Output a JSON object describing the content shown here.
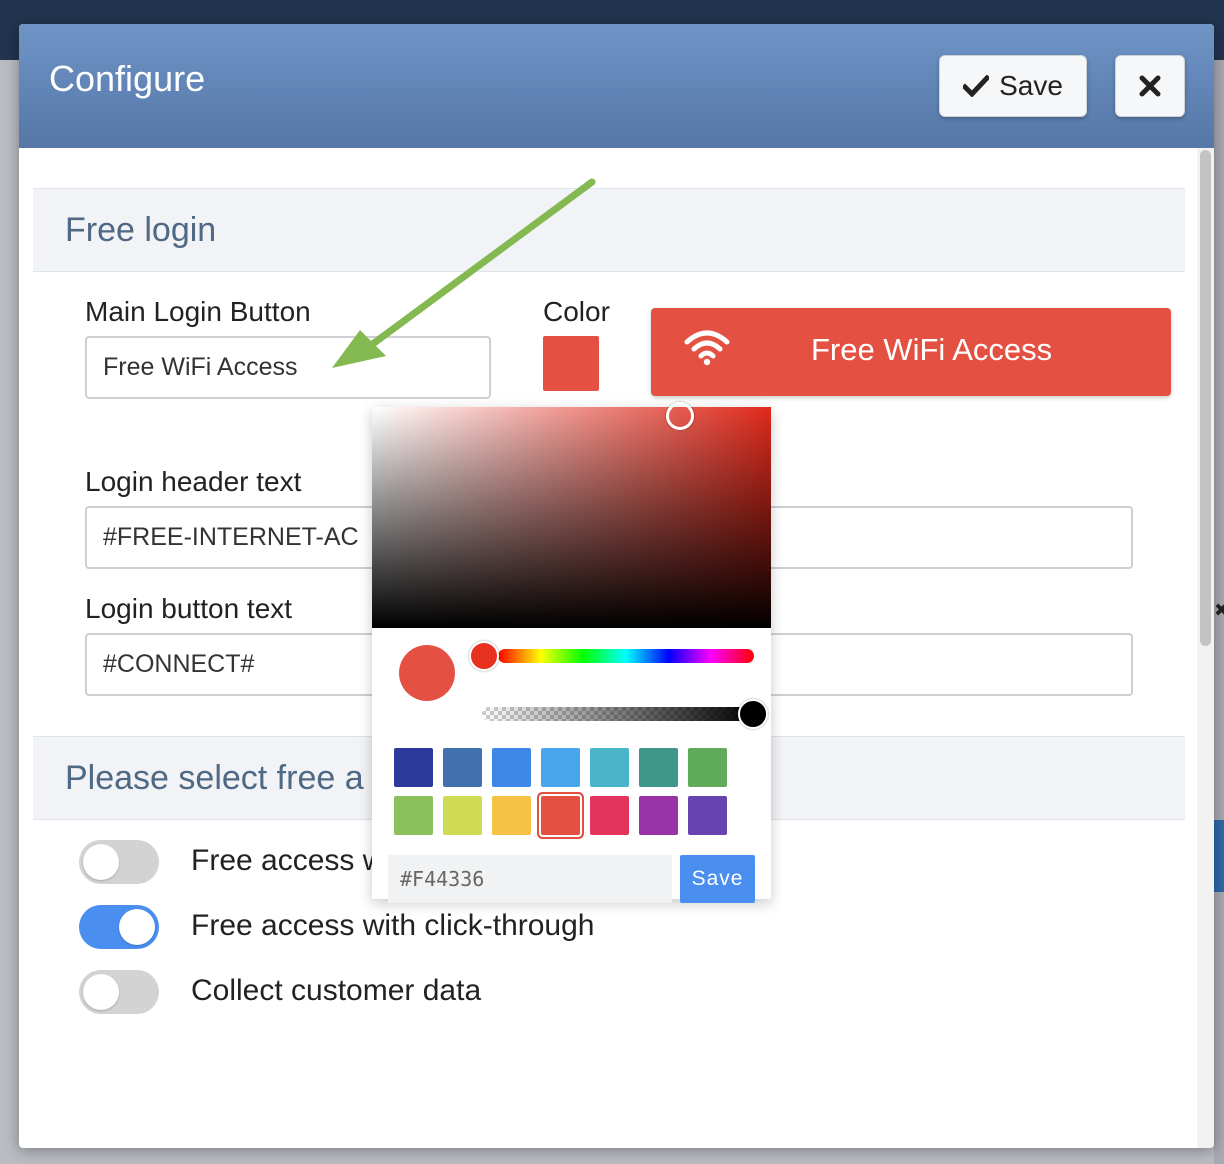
{
  "dialog": {
    "title": "Configure",
    "save_label": "Save",
    "save_icon": "check-icon",
    "close_icon": "close-icon"
  },
  "section_free_login": {
    "title": "Free login"
  },
  "main_login_button": {
    "label": "Main Login Button",
    "value": "Free WiFi Access"
  },
  "color": {
    "label": "Color",
    "value": "#F44336"
  },
  "preview_button": {
    "icon": "wifi-icon",
    "label": "Free WiFi Access",
    "color": "#e45142"
  },
  "login_header_text": {
    "label": "Login header text",
    "value": "#FREE-INTERNET-AC"
  },
  "login_button_text": {
    "label": "Login button text",
    "value": "#CONNECT#"
  },
  "section_select": {
    "title": "Please select free a"
  },
  "options": [
    {
      "label": "Free access w",
      "on": false
    },
    {
      "label": "Free access with click-through",
      "on": true
    },
    {
      "label": "Collect customer data",
      "on": false
    }
  ],
  "color_picker": {
    "hex_value": "#F44336",
    "save_label": "Save",
    "hue_position": 0.0,
    "alpha": 1.0,
    "swatches": [
      {
        "color": "#2c3a9b",
        "selected": false
      },
      {
        "color": "#4070ad",
        "selected": false
      },
      {
        "color": "#3d87e6",
        "selected": false
      },
      {
        "color": "#4aa6ec",
        "selected": false
      },
      {
        "color": "#4ab4c8",
        "selected": false
      },
      {
        "color": "#3d9687",
        "selected": false
      },
      {
        "color": "#5fab5a",
        "selected": false
      },
      {
        "color": "#8cc05b",
        "selected": false
      },
      {
        "color": "#d0db55",
        "selected": false
      },
      {
        "color": "#f6c243",
        "selected": false
      },
      {
        "color": "#e45142",
        "selected": true
      },
      {
        "color": "#e2345d",
        "selected": false
      },
      {
        "color": "#9a32a8",
        "selected": false
      },
      {
        "color": "#6742b1",
        "selected": false
      }
    ]
  },
  "colors": {
    "header_bg": "#6388bb",
    "accent_blue": "#4a8ef0",
    "brand_red": "#e45142",
    "annotation_arrow": "#84b951"
  }
}
